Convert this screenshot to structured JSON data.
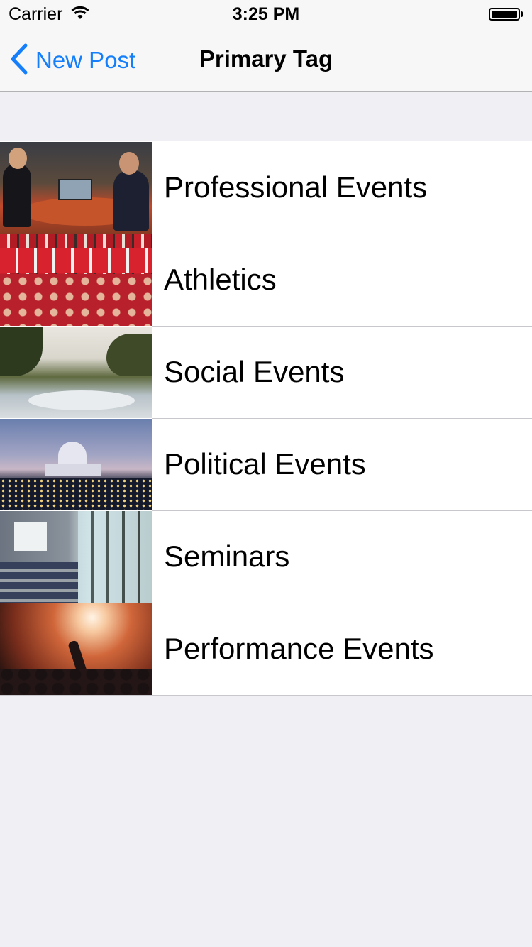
{
  "status_bar": {
    "carrier": "Carrier",
    "time": "3:25 PM"
  },
  "nav": {
    "back_label": "New Post",
    "title": "Primary Tag"
  },
  "items": [
    {
      "label": "Professional Events",
      "thumb": "professional-events-photo"
    },
    {
      "label": "Athletics",
      "thumb": "athletics-photo"
    },
    {
      "label": "Social Events",
      "thumb": "social-events-photo"
    },
    {
      "label": "Political Events",
      "thumb": "political-events-photo"
    },
    {
      "label": "Seminars",
      "thumb": "seminars-photo"
    },
    {
      "label": "Performance Events",
      "thumb": "performance-events-photo"
    }
  ],
  "colors": {
    "accent": "#147efb",
    "background": "#efeff4",
    "separator": "#c8c7cc"
  }
}
